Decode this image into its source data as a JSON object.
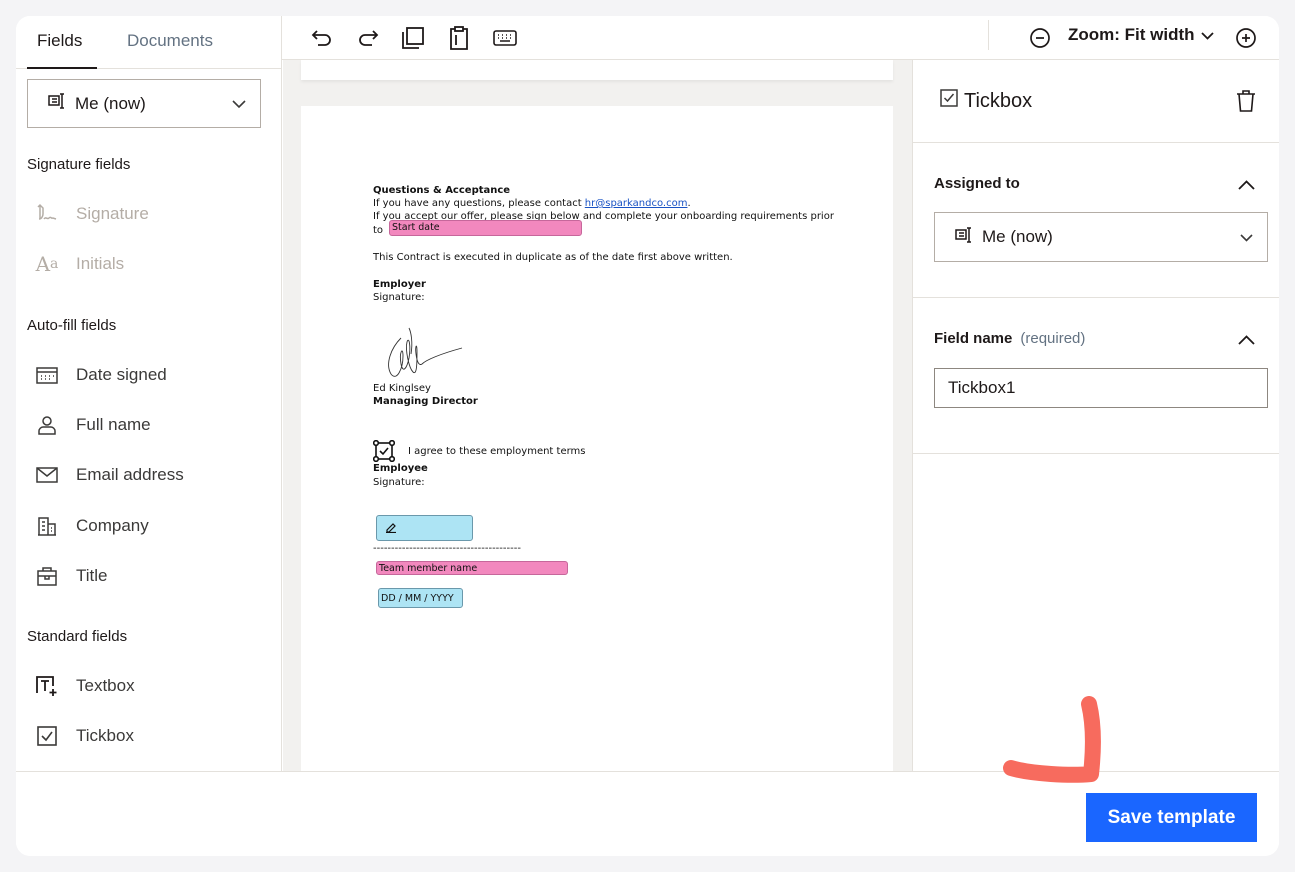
{
  "sidebar": {
    "tabs": [
      {
        "label": "Fields"
      },
      {
        "label": "Documents"
      }
    ],
    "assignee": "Me (now)",
    "signature_heading": "Signature fields",
    "signature_fields": [
      {
        "label": "Signature",
        "icon": "signature-icon"
      },
      {
        "label": "Initials",
        "icon": "initials-icon"
      }
    ],
    "autofill_heading": "Auto-fill fields",
    "autofill_fields": [
      {
        "label": "Date signed",
        "icon": "calendar-icon"
      },
      {
        "label": "Full name",
        "icon": "person-icon"
      },
      {
        "label": "Email address",
        "icon": "envelope-icon"
      },
      {
        "label": "Company",
        "icon": "building-icon"
      },
      {
        "label": "Title",
        "icon": "briefcase-icon"
      }
    ],
    "standard_heading": "Standard fields",
    "standard_fields": [
      {
        "label": "Textbox",
        "icon": "textbox-icon"
      },
      {
        "label": "Tickbox",
        "icon": "tickbox-icon"
      }
    ]
  },
  "toolbar": {
    "zoom": "Zoom: Fit width"
  },
  "document": {
    "heading": "Questions & Acceptance",
    "line1_prefix": "If you have any questions, please contact ",
    "line1_email": "hr@sparkandco.com",
    "line1_suffix": ".",
    "line2": "If you accept our offer, please sign below and complete your onboarding requirements prior",
    "line3": "to",
    "start_date_field": "Start date",
    "executed": "This Contract is executed in duplicate as of the date first above written.",
    "employer_label": "Employer",
    "signature_label": "Signature:",
    "signer_name": "Ed Kinglsey",
    "signer_title": "Managing Director",
    "agree_text": "I agree to these employment terms",
    "employee_label": "Employee",
    "employee_signature_label": "Signature:",
    "dashes": "-----------------------------------------",
    "team_member_field": "Team member name",
    "date_field": "DD / MM / YYYY"
  },
  "panel": {
    "title": "Tickbox",
    "assigned_label": "Assigned to",
    "assigned_value": "Me (now)",
    "field_name_label": "Field name",
    "field_name_hint": "(required)",
    "field_name_value": "Tickbox1"
  },
  "footer": {
    "save_label": "Save template"
  },
  "colors": {
    "accent": "#1a66ff",
    "pink_field": "#f288be",
    "blue_field": "#ade4f4",
    "annotation": "#f76b5e"
  }
}
